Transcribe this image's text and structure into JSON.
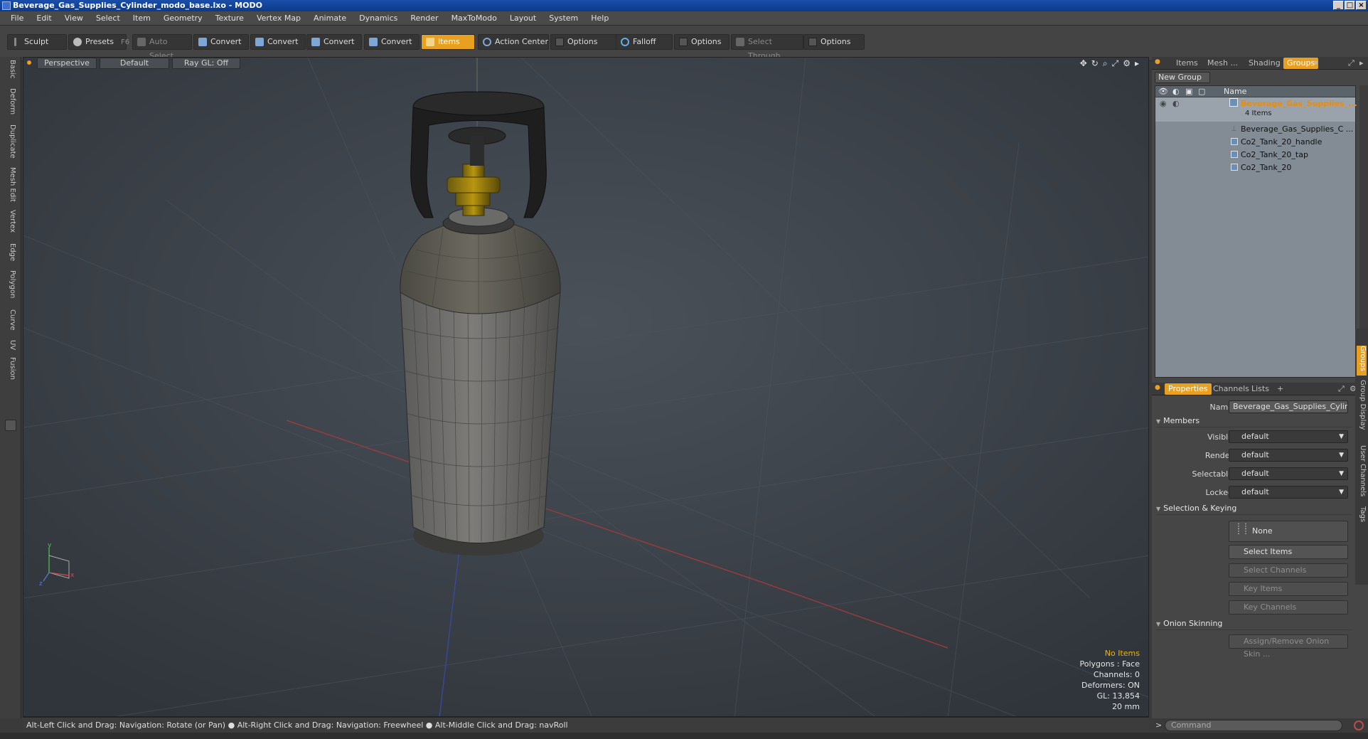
{
  "window": {
    "title": "Beverage_Gas_Supplies_Cylinder_modo_base.lxo - MODO"
  },
  "menu": [
    "File",
    "Edit",
    "View",
    "Select",
    "Item",
    "Geometry",
    "Texture",
    "Vertex Map",
    "Animate",
    "Dynamics",
    "Render",
    "MaxToModo",
    "Layout",
    "System",
    "Help"
  ],
  "toolbar": {
    "sculpt": "Sculpt",
    "presets": "Presets",
    "presets_key": "F6",
    "auto_select": "Auto Select",
    "convert1": "Convert",
    "convert2": "Convert",
    "convert3": "Convert",
    "convert4": "Convert",
    "items": "Items",
    "action_center": "Action Center",
    "options1": "Options",
    "falloff": "Falloff",
    "options2": "Options",
    "select_through": "Select Through",
    "options3": "Options"
  },
  "left_tabs": [
    "Basic",
    "Deform",
    "Duplicate",
    "Mesh Edit",
    "Vertex",
    "Edge",
    "Polygon",
    "Curve",
    "UV",
    "Fusion"
  ],
  "viewport": {
    "view": "Perspective",
    "shading": "Default",
    "raygl": "Ray GL: Off",
    "hud": {
      "items": "No Items",
      "polygons": "Polygons : Face",
      "channels": "Channels: 0",
      "deformers": "Deformers: ON",
      "gl": "GL: 13,854",
      "scale": "20 mm"
    }
  },
  "status": "Alt-Left Click and Drag: Navigation: Rotate (or Pan) ● Alt-Right Click and Drag: Navigation: Freewheel ● Alt-Middle Click and Drag: navRoll",
  "top_panel": {
    "tabs": [
      "Items",
      "Mesh ...",
      "Shading",
      "Groups"
    ],
    "active_tab": "Groups",
    "new_group": "New Group",
    "header_name": "Name",
    "group_name": "Beverage_Gas_Supplies_...",
    "group_count": "4 Items",
    "children": [
      "Beverage_Gas_Supplies_C ...",
      "Co2_Tank_20_handle",
      "Co2_Tank_20_tap",
      "Co2_Tank_20"
    ]
  },
  "props_panel": {
    "tabs": [
      "Properties",
      "Channels",
      "Lists",
      "+"
    ],
    "name_label": "Name",
    "name_value": "Beverage_Gas_Supplies_Cylinde",
    "members": "Members",
    "visible_label": "Visible",
    "render_label": "Render",
    "selectable_label": "Selectable",
    "locked_label": "Locked",
    "default_value": "default",
    "selection_keying": "Selection & Keying",
    "none": "None",
    "select_items": "Select Items",
    "select_channels": "Select Channels",
    "key_items": "Key Items",
    "key_channels": "Key Channels",
    "onion_skinning": "Onion Skinning",
    "assign_onion": "Assign/Remove Onion Skin ..."
  },
  "right_vtabs": [
    "Groups",
    "Group Display",
    "User Channels",
    "Tags"
  ],
  "command": {
    "placeholder": "Command",
    "prompt": ">"
  },
  "colors": {
    "accent": "#e8a020",
    "viewport_bg": "#3b4148",
    "panel_bg": "#464646",
    "tree_bg": "#838c95",
    "highlight_text": "#f0b400"
  }
}
